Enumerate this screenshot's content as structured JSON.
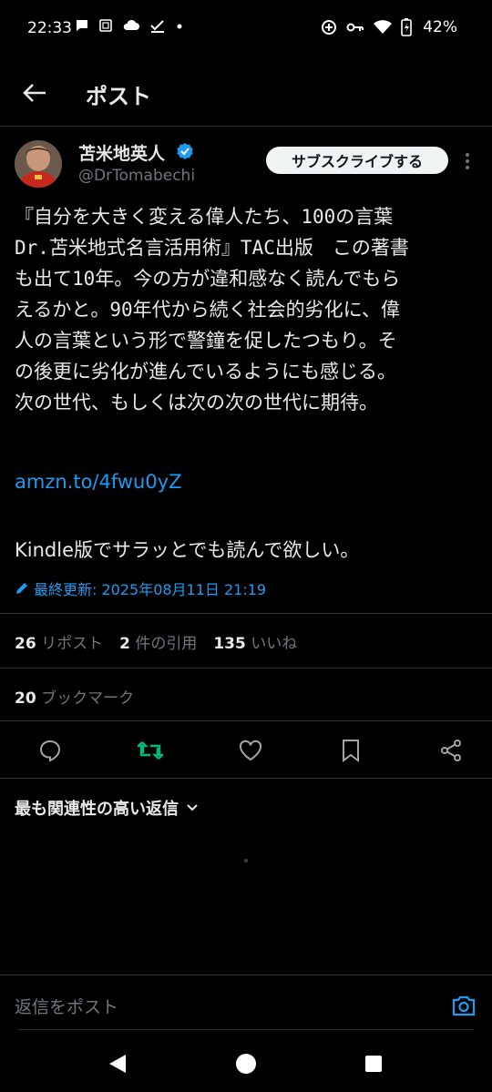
{
  "status_bar": {
    "time": "22:33",
    "battery": "42%",
    "icons": [
      "chat-bubble-icon",
      "screenshot-icon",
      "cloud-icon",
      "check-icon",
      "dot-icon",
      "data-saver-icon",
      "vpn-key-icon",
      "wifi-icon",
      "battery-charging-icon"
    ]
  },
  "header": {
    "title": "ポスト"
  },
  "author": {
    "name": "苫米地英人",
    "handle": "@DrTomabechi",
    "verified": true,
    "subscribe_label": "サブスクライブする"
  },
  "tweet": {
    "text": "『自分を大きく変える偉人たち、100の言葉\nDr.苫米地式名言活用術』TAC出版　この著書\nも出て10年。今の方が違和感なく読んでもら\nえるかと。90年代から続く社会的劣化に、偉\n人の言葉という形で警鐘を促したつもり。そ\nの後更に劣化が進んでいるようにも感じる。\n次の世代、もしくは次の次の世代に期待。",
    "link": "amzn.to/4fwu0yZ",
    "text2": "Kindle版でサラッとでも読んで欲しい。",
    "edited": "最終更新: 2025年08月11日 21:19"
  },
  "stats": {
    "reposts_count": "26",
    "reposts_label": "リポスト",
    "quotes_count": "2",
    "quotes_label": "件の引用",
    "likes_count": "135",
    "likes_label": "いいね",
    "bookmarks_count": "20",
    "bookmarks_label": "ブックマーク"
  },
  "replies": {
    "sort_label": "最も関連性の高い返信",
    "input_placeholder": "返信をポスト"
  },
  "colors": {
    "background": "#000000",
    "accent": "#1d9bf0",
    "repost_active": "#00ba7c",
    "muted": "#71767b",
    "divider": "#2f3336"
  }
}
